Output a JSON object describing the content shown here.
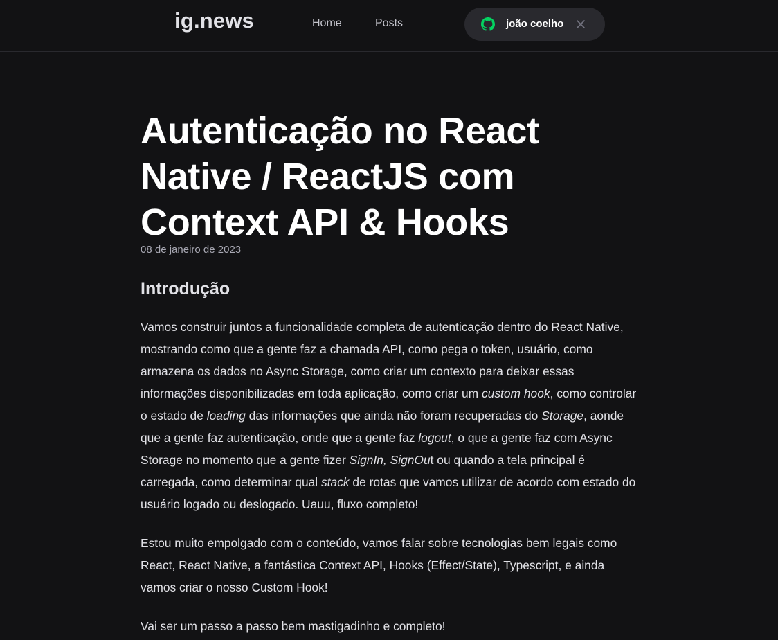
{
  "header": {
    "logo": "ig.news",
    "nav": [
      {
        "label": "Home"
      },
      {
        "label": "Posts"
      }
    ],
    "user": {
      "name": "joão coelho",
      "icon": "github-icon",
      "icon_color": "#04d361",
      "close_icon": "close-icon"
    }
  },
  "post": {
    "title": "Autenticação no React Native / ReactJS com Context API & Hooks",
    "date": "08 de janeiro de 2023",
    "heading": "Introdução",
    "p1": {
      "t1": "Vamos construir juntos a funcionalidade completa de autenticação dentro do React Native, mostrando como que a gente faz a chamada API, como pega o token, usuário, como armazena os dados no Async Storage, como criar um contexto para deixar essas informações disponibilizadas em toda aplicação, como  criar um ",
      "e1": "custom hook",
      "t2": ", como controlar o estado de ",
      "e2": "loading",
      "t3": " das informações que ainda não foram recuperadas do ",
      "e3": "Storage",
      "t4": ", aonde que a gente faz autenticação, onde que a gente faz ",
      "e4": "logout",
      "t5": ",  o que a gente faz com Async Storage no momento que a gente fizer ",
      "e5": "SignIn, SignOu",
      "t6": "t ou quando a tela principal é carregada, como determinar qual ",
      "e6": "stack",
      "t7": " de rotas que vamos utilizar de acordo com estado do usuário logado ou deslogado. Uauu, fluxo completo!"
    },
    "p2": "Estou muito empolgado com o conteúdo, vamos falar sobre tecnologias bem legais como React, React Native, a fantástica Context API, Hooks (Effect/State), Typescript, e ainda vamos criar o nosso Custom Hook!",
    "p3": "Vai ser um passo a passo bem mastigadinho e completo!"
  },
  "colors": {
    "background": "#121214",
    "accent": "#04d361",
    "button_bg": "#29292e"
  }
}
